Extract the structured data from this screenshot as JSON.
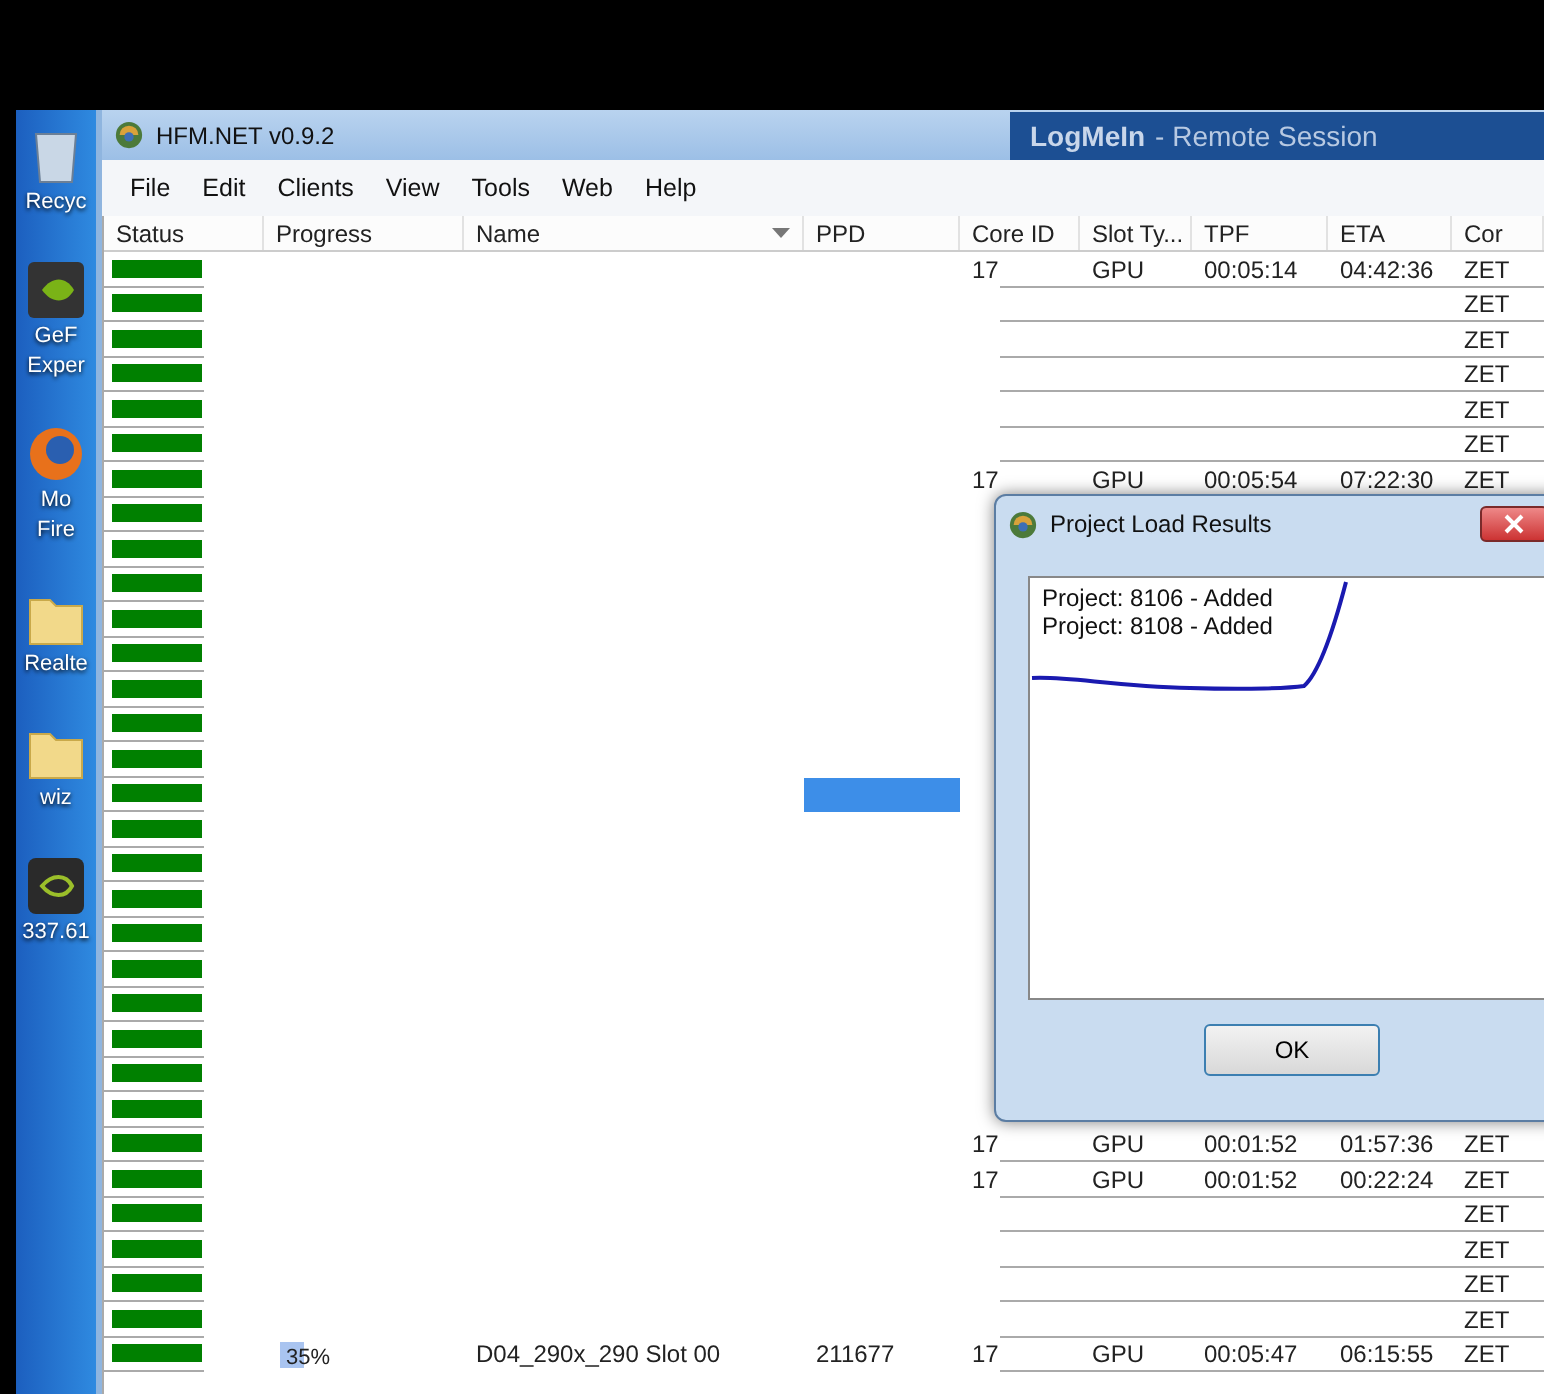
{
  "desktop": {
    "icons": [
      {
        "kind": "bin",
        "lines": [
          "Recyc"
        ]
      },
      {
        "kind": "app",
        "lines": [
          "GeF",
          "Exper"
        ]
      },
      {
        "kind": "browser",
        "lines": [
          "Mo",
          "Fire"
        ]
      },
      {
        "kind": "folder",
        "lines": [
          "Realte"
        ]
      },
      {
        "kind": "folder",
        "lines": [
          "wiz"
        ]
      },
      {
        "kind": "gpu",
        "lines": [
          "337.61"
        ]
      }
    ]
  },
  "window": {
    "title": "HFM.NET v0.9.2",
    "remote_title": "LogMeIn",
    "remote_subtitle": "- Remote Session"
  },
  "menu": [
    "File",
    "Edit",
    "Clients",
    "View",
    "Tools",
    "Web",
    "Help"
  ],
  "table": {
    "columns": [
      "Status",
      "Progress",
      "Name",
      "PPD",
      "Core ID",
      "Slot Ty...",
      "TPF",
      "ETA",
      "Cor"
    ],
    "rows": [
      {
        "color": "#008000",
        "selected": false,
        "core_id": "17",
        "slot": "GPU",
        "tpf": "00:05:14",
        "eta": "04:42:36",
        "core": "ZET"
      },
      {
        "color": "#008000",
        "selected": false,
        "core": "ZET"
      },
      {
        "color": "#008000",
        "selected": false,
        "core": "ZET"
      },
      {
        "color": "#008000",
        "selected": false,
        "core": "ZET"
      },
      {
        "color": "#008000",
        "selected": false,
        "core": "ZET"
      },
      {
        "color": "#008000",
        "selected": false,
        "core": "ZET"
      },
      {
        "color": "#008000",
        "selected": false,
        "core_id": "17",
        "slot": "GPU",
        "tpf": "00:05:54",
        "eta": "07:22:30",
        "core": "ZET"
      },
      {
        "color": "#008000",
        "selected": false
      },
      {
        "color": "#008000",
        "selected": false
      },
      {
        "color": "#008000",
        "selected": false
      },
      {
        "color": "#008000",
        "selected": false
      },
      {
        "color": "#008000",
        "selected": false
      },
      {
        "color": "#008000",
        "selected": false
      },
      {
        "color": "#008000",
        "selected": false
      },
      {
        "color": "#008000",
        "selected": false
      },
      {
        "color": "#008000",
        "selected": true
      },
      {
        "color": "#008000",
        "selected": false
      },
      {
        "color": "#008000",
        "selected": false
      },
      {
        "color": "#008000",
        "selected": false
      },
      {
        "color": "#008000",
        "selected": false
      },
      {
        "color": "#008000",
        "selected": false
      },
      {
        "color": "#008000",
        "selected": false
      },
      {
        "color": "#008000",
        "selected": false
      },
      {
        "color": "#008000",
        "selected": false
      },
      {
        "color": "#008000",
        "selected": false
      },
      {
        "color": "#008000",
        "selected": false,
        "core_id": "17",
        "slot": "GPU",
        "tpf": "00:01:52",
        "eta": "01:57:36",
        "core": "ZET"
      },
      {
        "color": "#008000",
        "selected": false,
        "core_id": "17",
        "slot": "GPU",
        "tpf": "00:01:52",
        "eta": "00:22:24",
        "core": "ZET"
      },
      {
        "color": "#008000",
        "selected": false,
        "core": "ZET"
      },
      {
        "color": "#008000",
        "selected": false,
        "core": "ZET"
      },
      {
        "color": "#008000",
        "selected": false,
        "core": "ZET"
      },
      {
        "color": "#008000",
        "selected": false,
        "core": "ZET"
      },
      {
        "color": "#008000",
        "selected": false,
        "progress": "35%",
        "level": 0.35,
        "name": "D04_290x_290 Slot 00",
        "ppd": "211677",
        "core_id": "17",
        "slot": "GPU",
        "tpf": "00:05:47",
        "eta": "06:15:55",
        "core": "ZET"
      }
    ]
  },
  "dialog": {
    "title": "Project Load Results",
    "lines": [
      "Project: 8106 - Added",
      "Project: 8108 - Added"
    ],
    "button": "OK"
  }
}
